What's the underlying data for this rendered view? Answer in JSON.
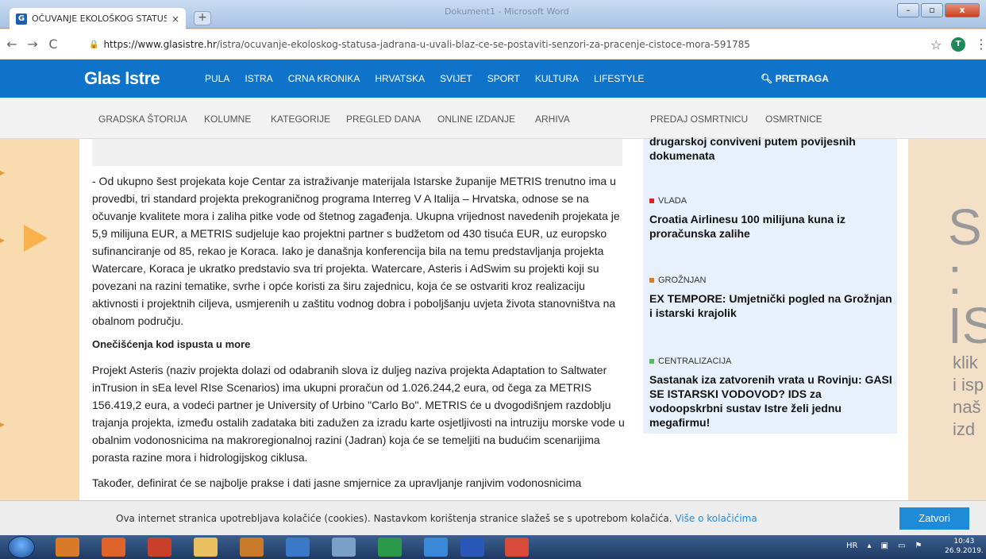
{
  "window": {
    "tab_title": "OČUVANJE EKOLOŠKOG STATUS",
    "tab_favicon": "G",
    "tab_close": "×",
    "new_tab": "+",
    "doc_title": "Dokument1 - Microsoft Word",
    "min": "–",
    "max": "▫",
    "close": "x"
  },
  "address": {
    "back": "←",
    "forward": "→",
    "reload": "C",
    "url_host": "https://www.glasistre.hr",
    "url_path": "/istra/ocuvanje-ekoloskog-statusa-jadrana-u-uvali-blaz-ce-se-postaviti-senzori-za-pracenje-cistoce-mora-591785",
    "star": "☆",
    "avatar": "T",
    "menu": "⋮"
  },
  "site": {
    "logo": "Glas Istre",
    "nav": [
      "PULA",
      "ISTRA",
      "CRNA KRONIKA",
      "HRVATSKA",
      "SVIJET",
      "SPORT",
      "KULTURA",
      "LIFESTYLE"
    ],
    "search": "PRETRAGA",
    "subnav": [
      "GRADSKA ŠTORIJA",
      "KOLUMNE",
      "KATEGORIJE",
      "PREGLED DANA",
      "ONLINE IZDANJE",
      "ARHIVA"
    ],
    "subnav_right": [
      "PREDAJ OSMRTNICU",
      "OSMRTNICE"
    ]
  },
  "article": {
    "p1": "- Od ukupno šest projekata koje Centar za istraživanje materijala Istarske županije METRIS trenutno ima u provedbi, tri standard projekta prekograničnog programa Interreg V A Italija – Hrvatska, odnose se na očuvanje kvalitete mora i zaliha pitke vode od štetnog zagađenja. Ukupna vrijednost navedenih projekata je 5,9 milijuna EUR, a METRIS sudjeluje kao projektni partner s budžetom od 430 tisuća EUR, uz europsko sufinanciranje od 85, rekao je Koraca.        Iako je današnja konferencija bila na temu predstavljanja projekta Watercare, Koraca je ukratko predstavio sva tri projekta. Watercare, Asteris i AdSwim su projekti koji su povezani na razini tematike, svrhe i opće koristi za širu zajednicu, koja će se ostvariti kroz realizaciju aktivnosti i projektnih ciljeva, usmjerenih u zaštitu vodnog dobra i poboljšanju uvjeta života stanovništva na obalnom području.",
    "heading": "Onečišćenja kod ispusta u more",
    "p2": "Projekt Asteris (naziv projekta dolazi od odabranih slova iz duljeg naziva projekta Adaptation to Saltwater inTrusion in sEa level RIse Scenarios) ima ukupni proračun od 1.026.244,2 eura, od čega za METRIS 156.419,2 eura, a vodeći partner je University of Urbino \"Carlo Bo\". METRIS će u dvogodišnjem razdoblju trajanja projekta, između ostalih zadataka biti zadužen za izradu karte osjetljivosti na intruziju morske vode u obalnim vodonosnicima na makroregionalnoj razini (Jadran) koja će se temeljiti na budućim scenarijima porasta razine mora i hidrologijskog ciklusa.",
    "p3": "Također, definirat će se najbolje prakse i dati jasne smjernice za upravljanje ranjivim vodonosnicima"
  },
  "sidebar": {
    "top_title": "drugarskoj conviveni putem povijesnih dokumenata",
    "items": [
      {
        "category": "VLADA",
        "color": "#e02020",
        "title": "Croatia Airlinesu 100 milijuna kuna iz proračunska zalihe"
      },
      {
        "category": "GROŽNJAN",
        "color": "#e07a20",
        "title": "EX TEMPORE: Umjetnički pogled na Grožnjan i istarski krajolik"
      },
      {
        "category": "CENTRALIZACIJA",
        "color": "#5cb85c",
        "title": "Sastanak iza zatvorenih vrata u Rovinju: GASI SE ISTARSKI VODOVOD? IDS za vodoopskrbni sustav Istre želi jednu megafirmu!"
      }
    ]
  },
  "right_ad": {
    "big": "S\n:\nIS",
    "text": "klik\ni isp\nnaš\nizd"
  },
  "cookie": {
    "message": "Ova internet stranica upotrebljava kolačiće (cookies). Nastavkom korištenja stranice slažeš se s upotrebom kolačića.",
    "link": "Više o kolačićima",
    "button": "Zatvori"
  },
  "taskbar": {
    "lang": "HR",
    "time": "10:43",
    "date": "26.9.2019."
  }
}
